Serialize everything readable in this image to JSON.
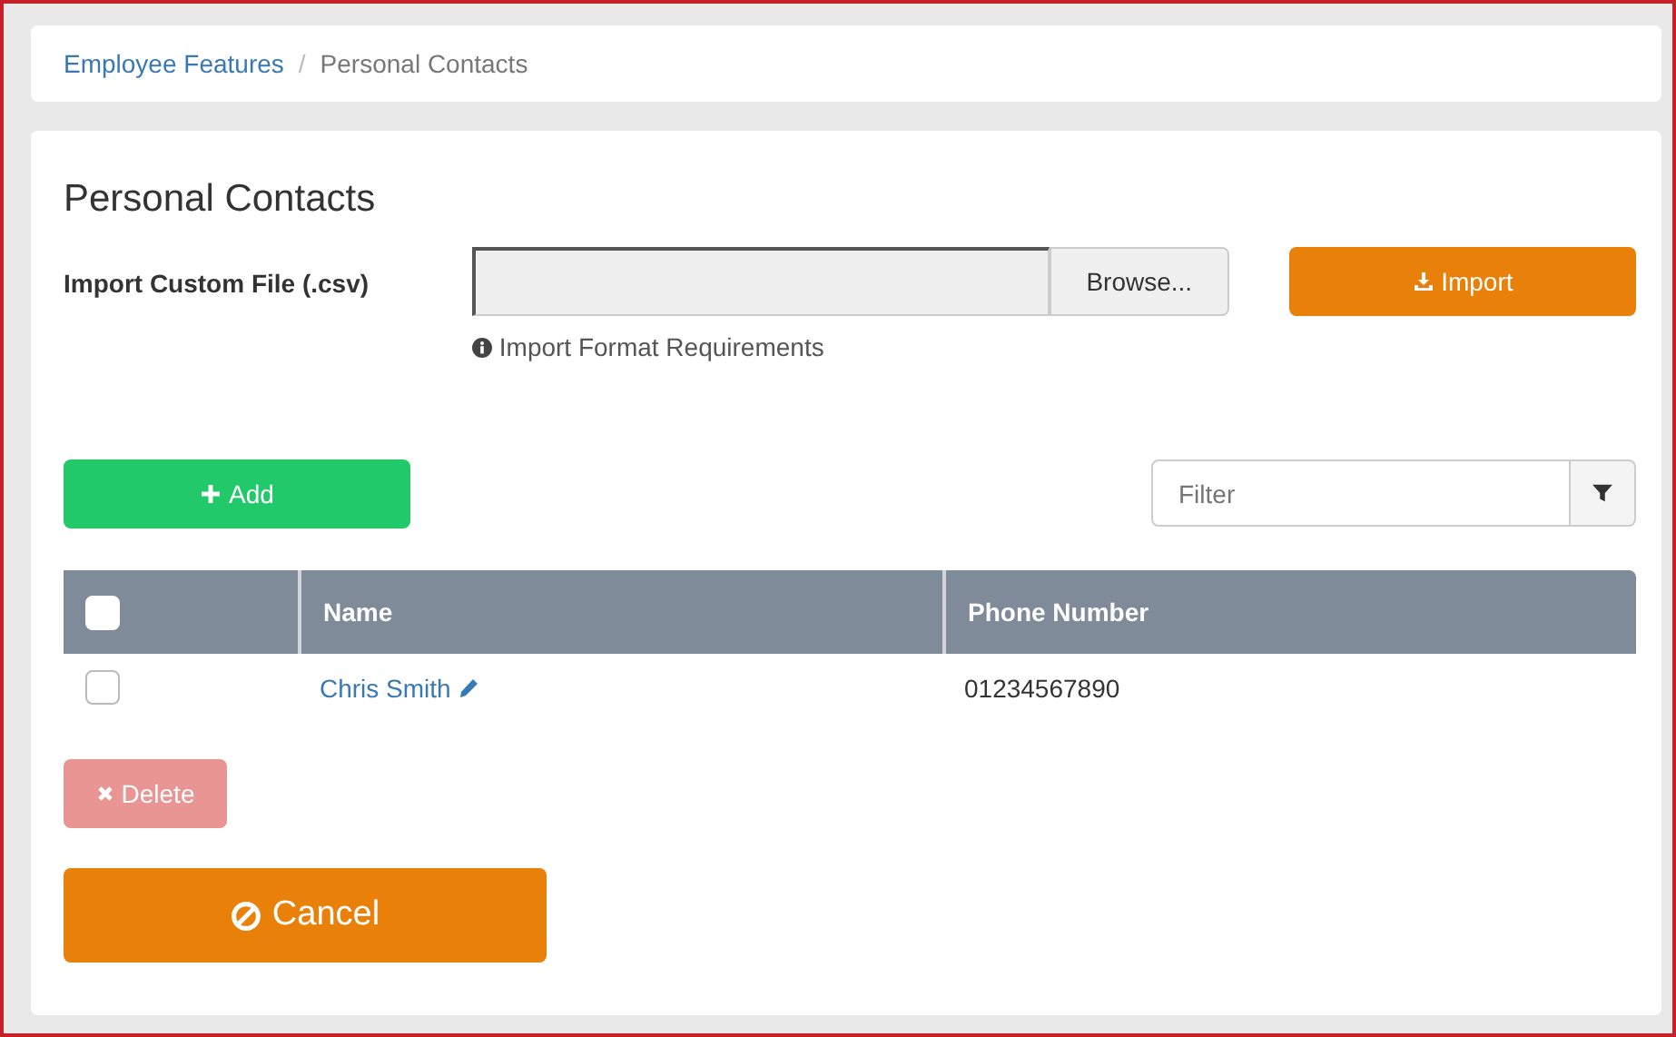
{
  "breadcrumb_separator": "/",
  "breadcrumb": [
    {
      "label": "Employee Features",
      "link": true
    },
    {
      "label": "Personal Contacts",
      "link": false
    }
  ],
  "title": "Personal Contacts",
  "import": {
    "label": "Import Custom File (.csv)",
    "browse": "Browse...",
    "button": "Import",
    "hint": "Import Format Requirements"
  },
  "add_button": "Add",
  "filter": {
    "placeholder": "Filter"
  },
  "table": {
    "select_all_checked": false,
    "columns": [
      "Name",
      "Phone Number"
    ],
    "rows": [
      {
        "checked": false,
        "name": "Chris Smith",
        "phone": "01234567890"
      }
    ]
  },
  "delete_button": {
    "label": "Delete",
    "disabled": true
  },
  "cancel_button": "Cancel"
}
